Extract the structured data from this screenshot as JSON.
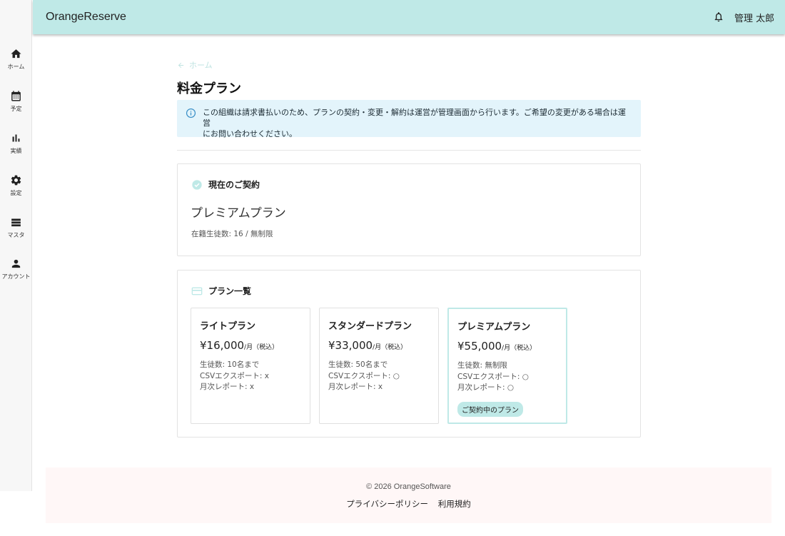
{
  "header": {
    "app_title": "OrangeReserve",
    "user_name": "管理 太郎"
  },
  "sidebar": {
    "items": [
      {
        "label": "ホーム",
        "icon": "home-icon"
      },
      {
        "label": "予定",
        "icon": "calendar-icon"
      },
      {
        "label": "実績",
        "icon": "bar-chart-icon"
      },
      {
        "label": "設定",
        "icon": "gear-icon"
      },
      {
        "label": "マスタ",
        "icon": "list-icon"
      },
      {
        "label": "アカウント",
        "icon": "person-icon"
      }
    ]
  },
  "main": {
    "back_label": "ホーム",
    "page_title": "料金プラン",
    "info_line1": "この組織は請求書払いのため、プランの契約・変更・解約は運営が管理画面から行います。ご希望の変更がある場合は運営",
    "info_line2": "にお問い合わせください。",
    "current": {
      "heading": "現在のご契約",
      "plan_name": "プレミアムプラン",
      "students": "在籍生徒数: 16 / 無制限"
    },
    "plan_list": {
      "heading": "プラン一覧",
      "plans": [
        {
          "name": "ライトプラン",
          "price": "¥16,000",
          "unit": "/月（税込）",
          "students": "生徒数: 10名まで",
          "csv": "CSVエクスポート: x",
          "report": "月次レポート: x"
        },
        {
          "name": "スタンダードプラン",
          "price": "¥33,000",
          "unit": "/月（税込）",
          "students": "生徒数: 50名まで",
          "csv": "CSVエクスポート: ○",
          "report": "月次レポート: x"
        },
        {
          "name": "プレミアムプラン",
          "price": "¥55,000",
          "unit": "/月（税込）",
          "students": "生徒数: 無制限",
          "csv": "CSVエクスポート: ○",
          "report": "月次レポート: ○",
          "badge": "ご契約中のプラン"
        }
      ]
    }
  },
  "footer": {
    "copyright": "© 2026 OrangeSoftware",
    "privacy": "プライバシーポリシー",
    "terms": "利用規約"
  },
  "colors": {
    "header_bg": "#bfe9e7",
    "accent": "#bfe9e7",
    "info_bg": "#e3f4fb",
    "info_icon": "#3a8fc7",
    "footer_bg": "#fff7f7"
  }
}
